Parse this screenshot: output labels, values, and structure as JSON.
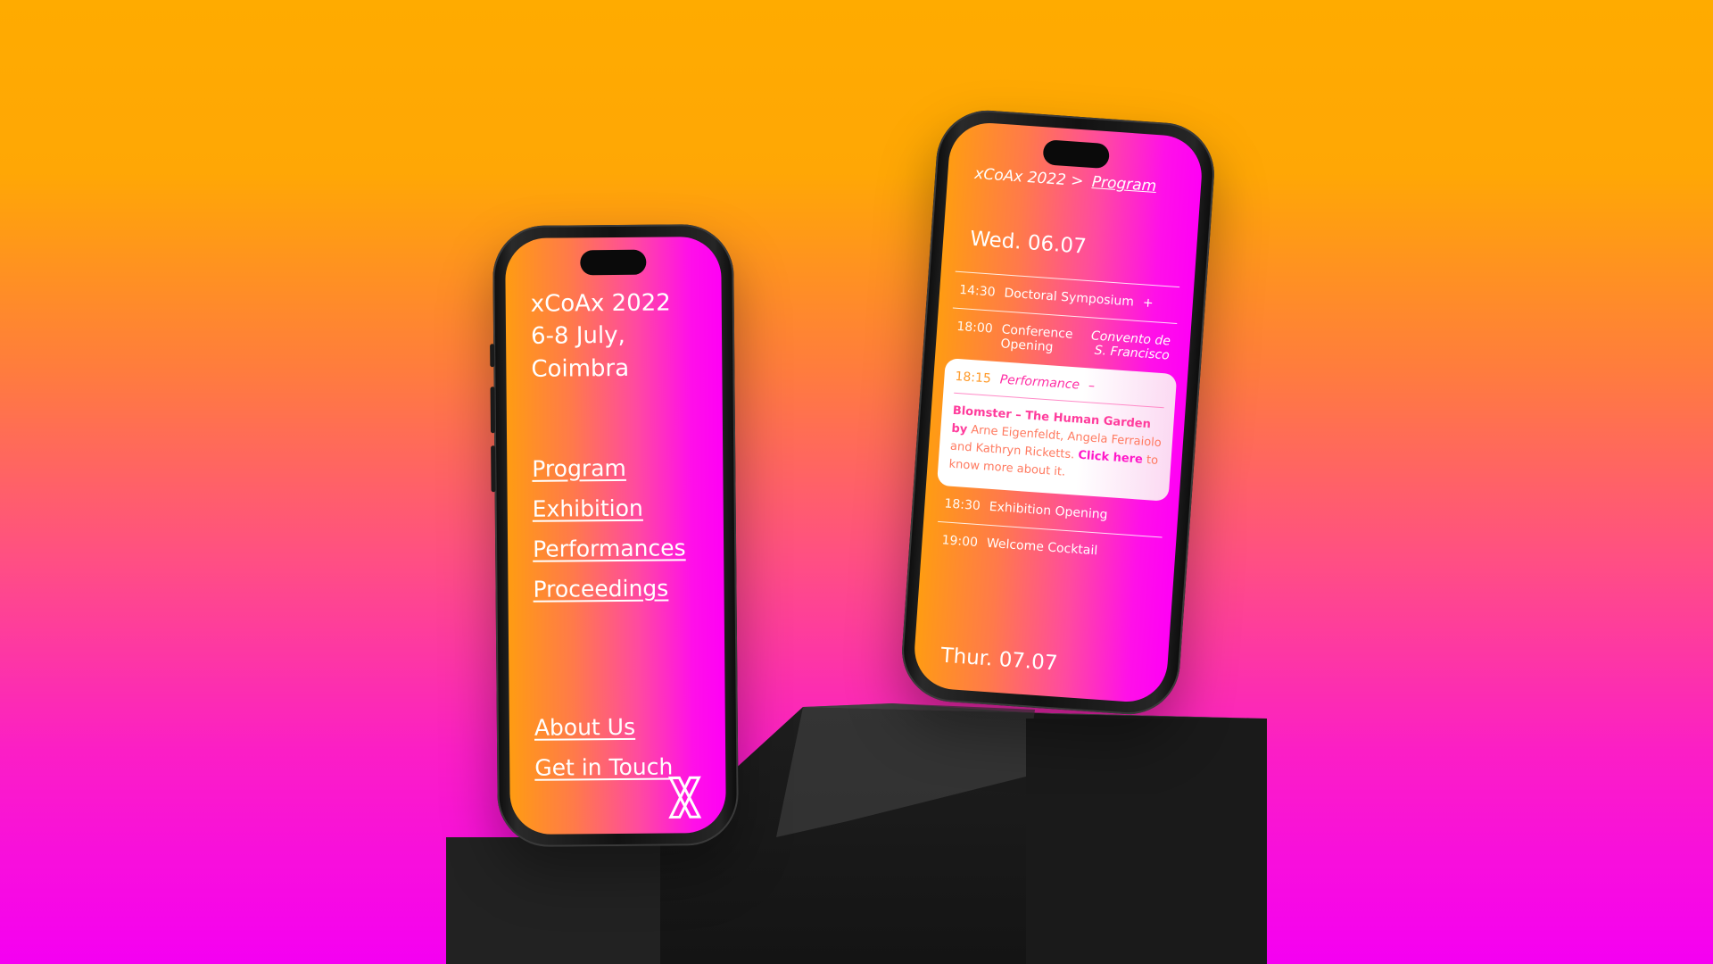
{
  "phone_menu": {
    "title": "xCoAx 2022",
    "subtitle": "6-8 July, Coimbra",
    "nav": [
      "Program",
      "Exhibition",
      "Performances",
      "Proceedings"
    ],
    "footer_nav": [
      "About Us",
      "Get in Touch"
    ],
    "logo_icon": "x-logo-icon"
  },
  "phone_program": {
    "breadcrumb_root": "xCoAx 2022",
    "breadcrumb_sep": ">",
    "breadcrumb_current": "Program",
    "day1": "Wed. 06.07",
    "events": [
      {
        "time": "14:30",
        "title": "Doctoral Symposium",
        "toggle": "+"
      },
      {
        "time": "18:00",
        "title": "Conference Opening",
        "venue": "Convento de S. Francisco"
      }
    ],
    "expanded": {
      "time": "18:15",
      "title": "Performance",
      "toggle": "–",
      "work": "Blomster – The Human Garden",
      "by": "by",
      "authors": "Arne Eigenfeldt, Angela Ferraiolo and Kathryn Ricketts.",
      "cta": "Click here",
      "tail": "to know more about it."
    },
    "events_after": [
      {
        "time": "18:30",
        "title": "Exhibition Opening"
      },
      {
        "time": "19:00",
        "title": "Welcome Cocktail"
      }
    ],
    "day2": "Thur. 07.07"
  },
  "colors": {
    "bg_top": "#ffab00",
    "bg_bottom": "#f500f2",
    "screen_left": "#ff9c12",
    "screen_right": "#ff00f5"
  }
}
